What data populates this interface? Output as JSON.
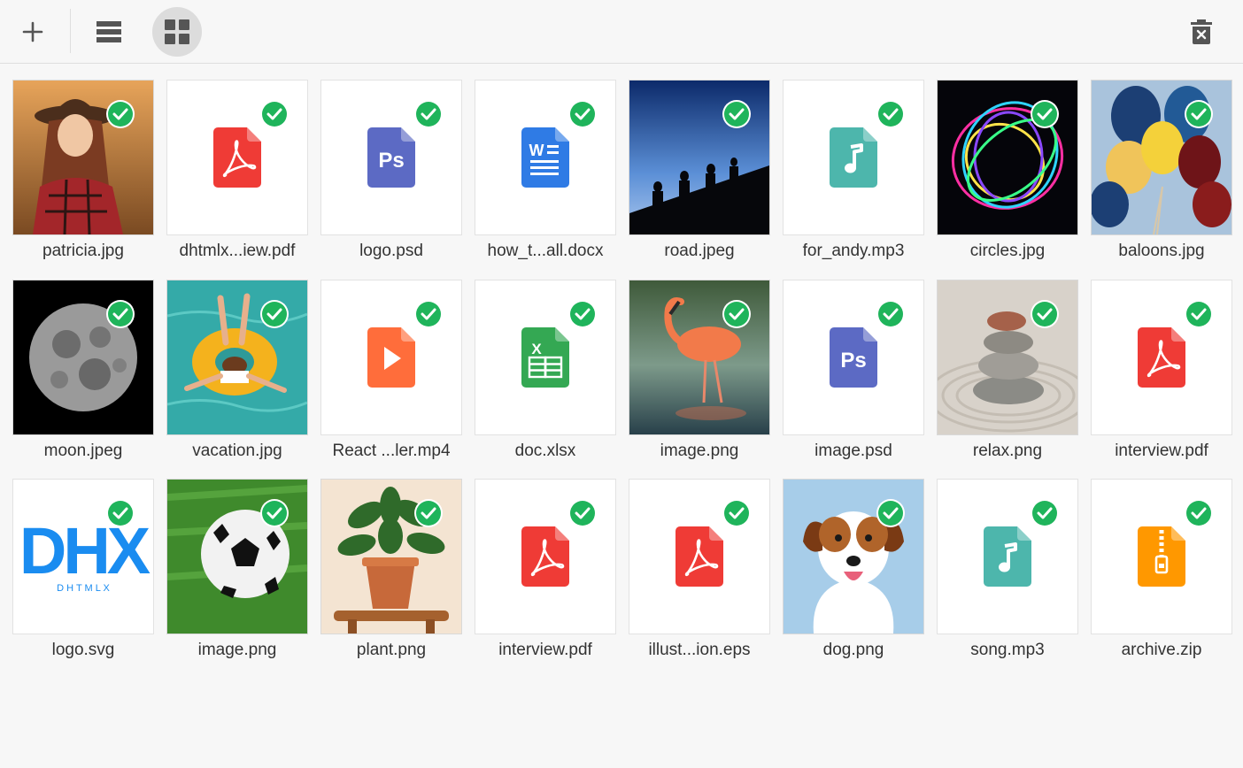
{
  "toolbar": {
    "buttons": [
      {
        "name": "add",
        "icon": "plus-icon"
      },
      {
        "name": "list-view",
        "icon": "list-icon"
      },
      {
        "name": "grid-view",
        "icon": "grid-icon",
        "active": true
      },
      {
        "name": "delete",
        "icon": "trash-icon"
      }
    ]
  },
  "colors": {
    "pdf": "#ef3b36",
    "psd": "#5c6ac4",
    "docx": "#2f7be5",
    "audio": "#4db6ac",
    "video": "#ff6d3b",
    "xlsx": "#34a853",
    "archive": "#ff9800",
    "check": "#1fb45b"
  },
  "files": [
    {
      "name": "patricia.jpg",
      "kind": "photo",
      "subject": "woman-in-hat"
    },
    {
      "name": "dhtmlx...iew.pdf",
      "kind": "pdf"
    },
    {
      "name": "logo.psd",
      "kind": "psd"
    },
    {
      "name": "how_t...all.docx",
      "kind": "docx"
    },
    {
      "name": "road.jpeg",
      "kind": "photo",
      "subject": "hikers-silhouette"
    },
    {
      "name": "for_andy.mp3",
      "kind": "audio"
    },
    {
      "name": "circles.jpg",
      "kind": "photo",
      "subject": "light-circles"
    },
    {
      "name": "baloons.jpg",
      "kind": "photo",
      "subject": "balloons"
    },
    {
      "name": "moon.jpeg",
      "kind": "photo",
      "subject": "moon"
    },
    {
      "name": "vacation.jpg",
      "kind": "photo",
      "subject": "swim-ring"
    },
    {
      "name": "React ...ler.mp4",
      "kind": "video"
    },
    {
      "name": "doc.xlsx",
      "kind": "xlsx"
    },
    {
      "name": "image.png",
      "kind": "photo",
      "subject": "flamingo"
    },
    {
      "name": "image.psd",
      "kind": "psd"
    },
    {
      "name": "relax.png",
      "kind": "photo",
      "subject": "stones"
    },
    {
      "name": "interview.pdf",
      "kind": "pdf"
    },
    {
      "name": "logo.svg",
      "kind": "logo",
      "logo_text": "DHX",
      "logo_subtext": "D H T M L X"
    },
    {
      "name": "image.png",
      "kind": "photo",
      "subject": "soccer-ball"
    },
    {
      "name": "plant.png",
      "kind": "photo",
      "subject": "potted-plant"
    },
    {
      "name": "interview.pdf",
      "kind": "pdf"
    },
    {
      "name": "illust...ion.eps",
      "kind": "pdf"
    },
    {
      "name": "dog.png",
      "kind": "photo",
      "subject": "dog"
    },
    {
      "name": "song.mp3",
      "kind": "audio"
    },
    {
      "name": "archive.zip",
      "kind": "archive"
    }
  ]
}
